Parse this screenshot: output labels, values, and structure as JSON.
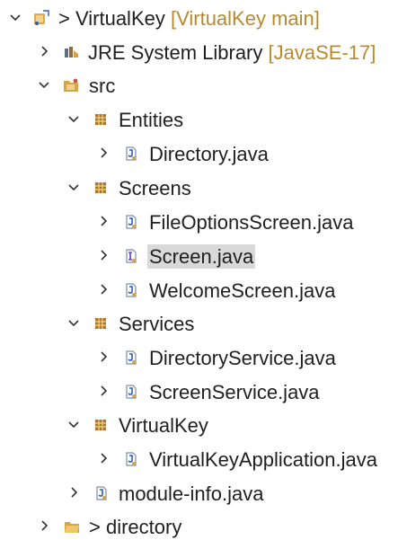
{
  "tree": {
    "project": {
      "label": "VirtualKey",
      "repo_prefix": ">",
      "decoration": "[VirtualKey main]"
    },
    "jre": {
      "label": "JRE System Library",
      "decoration": "[JavaSE-17]"
    },
    "src": {
      "label": "src"
    },
    "packages": {
      "entities": {
        "label": "Entities",
        "files": [
          "Directory.java"
        ]
      },
      "screens": {
        "label": "Screens",
        "files": [
          "FileOptionsScreen.java",
          "Screen.java",
          "WelcomeScreen.java"
        ]
      },
      "services": {
        "label": "Services",
        "files": [
          "DirectoryService.java",
          "ScreenService.java"
        ]
      },
      "virtualkey": {
        "label": "VirtualKey",
        "files": [
          "VirtualKeyApplication.java"
        ]
      }
    },
    "module_info": {
      "label": "module-info.java"
    },
    "directory": {
      "label": "directory",
      "prefix": ">"
    }
  },
  "icons": {
    "expanded": "chevron-down-icon",
    "collapsed": "chevron-right-icon",
    "project": "java-project-icon",
    "library": "library-icon",
    "source_folder": "source-folder-icon",
    "package": "package-icon",
    "java_file": "java-file-icon",
    "folder": "folder-icon"
  },
  "colors": {
    "decoration": "#b88a2d",
    "selection": "#d9d9d9",
    "text": "#1f1f1f",
    "java_file": "#2d5db7",
    "package": "#9b6a1b"
  }
}
